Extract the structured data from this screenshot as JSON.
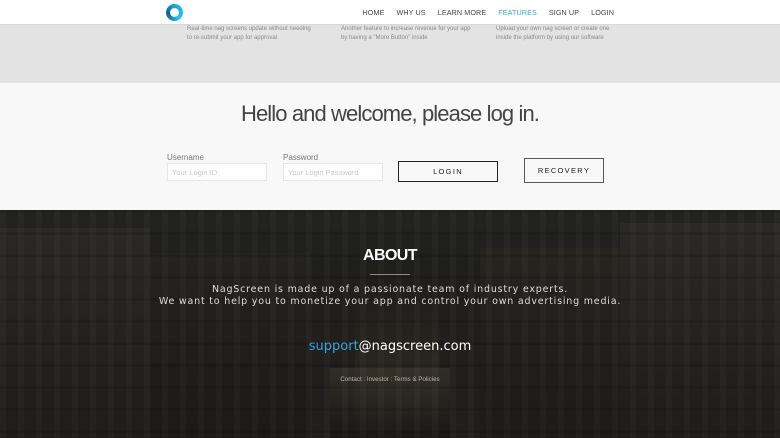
{
  "nav": {
    "items": [
      {
        "label": "HOME"
      },
      {
        "label": "WHY US"
      },
      {
        "label": "LEARN MORE"
      },
      {
        "label": "FEATURES",
        "active": true
      },
      {
        "label": "SIGN UP"
      },
      {
        "label": "LOGIN"
      }
    ],
    "accent_color": "#39a7dd"
  },
  "features": [
    {
      "text": "Real-time nag screens update without needing to re-submit your app for approval"
    },
    {
      "text": "Another feature to increase revenue for your app by having a \"More Button\" inside"
    },
    {
      "text": "Upload your own nag screen or create one inside the platform by using our software"
    }
  ],
  "login": {
    "heading": "Hello and welcome, please log in.",
    "username_label": "Username",
    "username_placeholder": "Your Login ID",
    "password_label": "Password",
    "password_placeholder": "Your Login Password",
    "login_button": "LOGIN",
    "recovery_button": "RECOVERY"
  },
  "about": {
    "title": "ABOUT",
    "line1": "NagScreen is made up of a passionate team of industry experts.",
    "line2": "We want to help you to monetize your app and control your own advertising media.",
    "email_user": "support",
    "email_domain": "@nagscreen.com",
    "email_user_color": "#3da0e0"
  },
  "footer": {
    "contact": "Contact",
    "separator": " : ",
    "investor": "Investor",
    "terms": "Terms & Policies"
  }
}
